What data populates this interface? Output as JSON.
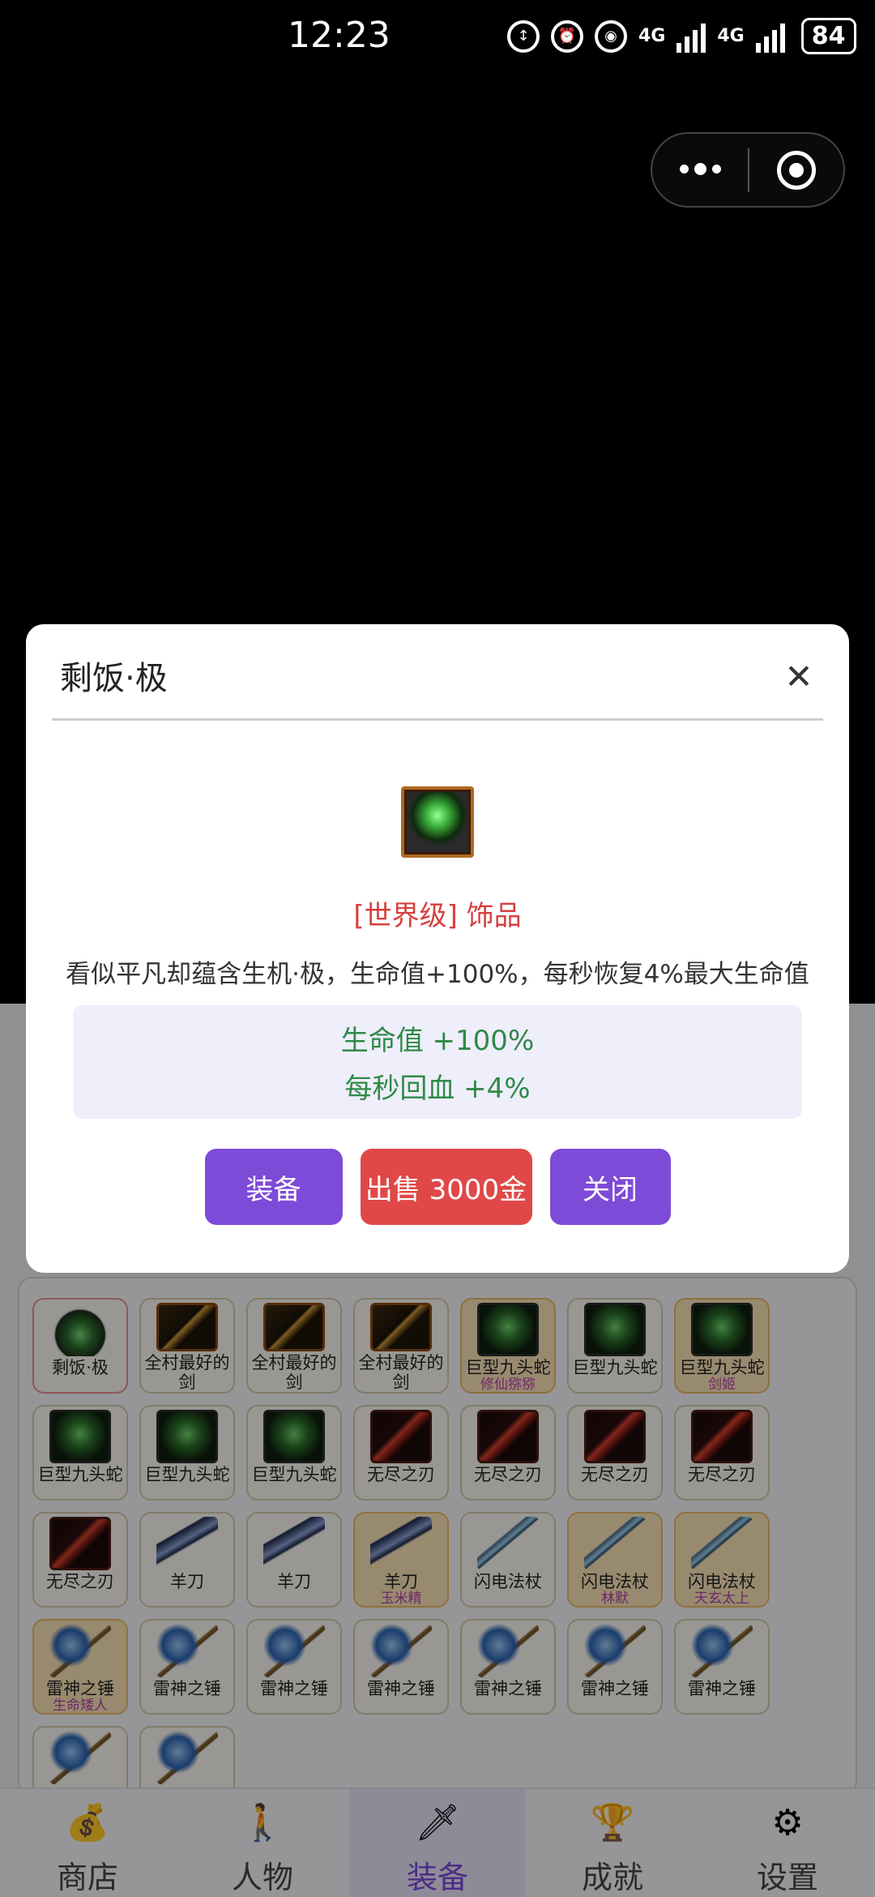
{
  "status_bar": {
    "time": "12:23",
    "battery": "84",
    "net1": "4G",
    "net2": "4G"
  },
  "modal": {
    "title": "剩饭·极",
    "close_glyph": "✕",
    "quality": "[世界级] 饰品",
    "description": "看似平凡却蕴含生机·极，生命值+100%，每秒恢复4%最大生命值",
    "stats": [
      "生命值 +100%",
      "每秒回血 +4%"
    ],
    "buttons": {
      "equip": "装备",
      "sell": "出售 3000金",
      "close": "关闭"
    }
  },
  "inventory": {
    "items": [
      {
        "name": "剩饭·极",
        "owner": "",
        "icon": "rice-icon",
        "style": "sel"
      },
      {
        "name": "全村最好的剑",
        "owner": "",
        "icon": "sword-icon",
        "style": "normal"
      },
      {
        "name": "全村最好的剑",
        "owner": "",
        "icon": "sword-icon",
        "style": "normal"
      },
      {
        "name": "全村最好的剑",
        "owner": "",
        "icon": "sword-icon",
        "style": "normal"
      },
      {
        "name": "巨型九头蛇",
        "owner": "修仙猕猕",
        "icon": "hydra-icon",
        "style": "orange"
      },
      {
        "name": "巨型九头蛇",
        "owner": "",
        "icon": "hydra-icon",
        "style": "normal"
      },
      {
        "name": "巨型九头蛇",
        "owner": "剑姬",
        "icon": "hydra-icon",
        "style": "orange"
      },
      {
        "name": "巨型九头蛇",
        "owner": "",
        "icon": "hydra-icon",
        "style": "normal"
      },
      {
        "name": "巨型九头蛇",
        "owner": "",
        "icon": "hydra-icon",
        "style": "normal"
      },
      {
        "name": "巨型九头蛇",
        "owner": "",
        "icon": "hydra-icon",
        "style": "normal"
      },
      {
        "name": "无尽之刃",
        "owner": "",
        "icon": "endless-blade-icon",
        "style": "normal"
      },
      {
        "name": "无尽之刃",
        "owner": "",
        "icon": "endless-blade-icon",
        "style": "normal"
      },
      {
        "name": "无尽之刃",
        "owner": "",
        "icon": "endless-blade-icon",
        "style": "normal"
      },
      {
        "name": "无尽之刃",
        "owner": "",
        "icon": "endless-blade-icon",
        "style": "normal"
      },
      {
        "name": "无尽之刃",
        "owner": "",
        "icon": "endless-blade-icon",
        "style": "normal"
      },
      {
        "name": "羊刀",
        "owner": "",
        "icon": "scimitar-icon",
        "style": "normal"
      },
      {
        "name": "羊刀",
        "owner": "",
        "icon": "scimitar-icon",
        "style": "normal"
      },
      {
        "name": "羊刀",
        "owner": "玉米精",
        "icon": "scimitar-icon",
        "style": "orange"
      },
      {
        "name": "闪电法杖",
        "owner": "",
        "icon": "staff-icon",
        "style": "normal"
      },
      {
        "name": "闪电法杖",
        "owner": "林默",
        "icon": "staff-icon",
        "style": "orange"
      },
      {
        "name": "闪电法杖",
        "owner": "天玄太上",
        "icon": "staff-icon",
        "style": "orange"
      },
      {
        "name": "雷神之锤",
        "owner": "生命矮人",
        "icon": "hammer-icon",
        "style": "orange"
      },
      {
        "name": "雷神之锤",
        "owner": "",
        "icon": "hammer-icon",
        "style": "normal"
      },
      {
        "name": "雷神之锤",
        "owner": "",
        "icon": "hammer-icon",
        "style": "normal"
      },
      {
        "name": "雷神之锤",
        "owner": "",
        "icon": "hammer-icon",
        "style": "normal"
      },
      {
        "name": "雷神之锤",
        "owner": "",
        "icon": "hammer-icon",
        "style": "normal"
      },
      {
        "name": "雷神之锤",
        "owner": "",
        "icon": "hammer-icon",
        "style": "normal"
      },
      {
        "name": "雷神之锤",
        "owner": "",
        "icon": "hammer-icon",
        "style": "normal"
      },
      {
        "name": "",
        "owner": "",
        "icon": "hammer-icon",
        "style": "normal"
      },
      {
        "name": "",
        "owner": "",
        "icon": "hammer-icon",
        "style": "normal"
      }
    ]
  },
  "nav": {
    "items": [
      {
        "label": "商店",
        "icon": "money-bag-icon",
        "glyph": "💰",
        "active": false
      },
      {
        "label": "人物",
        "icon": "person-icon",
        "glyph": "🚶",
        "active": false
      },
      {
        "label": "装备",
        "icon": "sword-icon",
        "glyph": "🗡",
        "active": true
      },
      {
        "label": "成就",
        "icon": "trophy-icon",
        "glyph": "🏆",
        "active": false
      },
      {
        "label": "设置",
        "icon": "gear-icon",
        "glyph": "⚙",
        "active": false
      }
    ]
  },
  "colors": {
    "accent": "#7e4ad8",
    "sell": "#e04848",
    "quality": "#d64040",
    "stat": "#2f8a48"
  }
}
